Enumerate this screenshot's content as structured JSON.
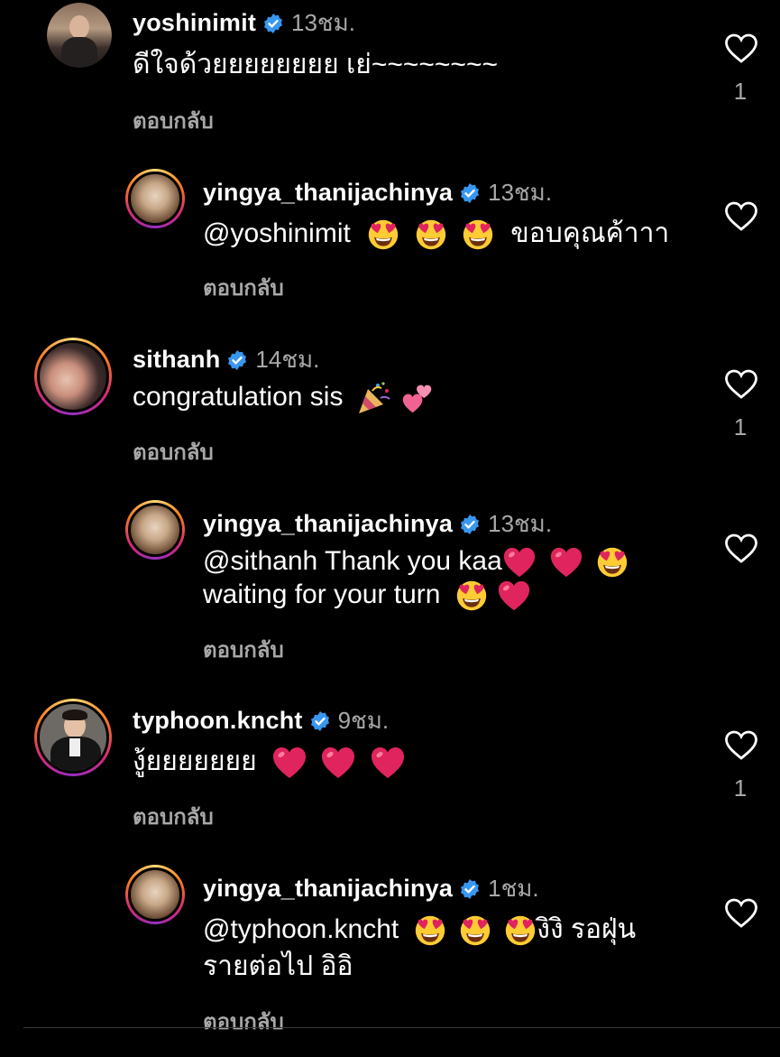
{
  "comments": [
    {
      "username": "yoshinimit",
      "time": "13ชม.",
      "text": "ดีใจด้วยยยยยยยย เย่~~~~~~~~",
      "reply_label": "ตอบกลับ",
      "likes": "1",
      "avatar_style": "plain"
    },
    {
      "username": "yingya_thanijachinya",
      "time": "13ชม.",
      "mention": "@yoshinimit",
      "text_after": "ขอบคุณค้าาา",
      "reply_label": "ตอบกลับ",
      "likes": ""
    },
    {
      "username": "sithanh",
      "time": "14ชม.",
      "text": "congratulation sis",
      "reply_label": "ตอบกลับ",
      "likes": "1"
    },
    {
      "username": "yingya_thanijachinya",
      "time": "13ชม.",
      "mention": "@sithanh",
      "text_line1": "Thank you kaa",
      "text_line2": "waiting for your turn",
      "reply_label": "ตอบกลับ",
      "likes": ""
    },
    {
      "username": "typhoon.kncht",
      "time": "9ชม.",
      "text": "งู้ยยยยยยย",
      "reply_label": "ตอบกลับ",
      "likes": "1"
    },
    {
      "username": "yingya_thanijachinya",
      "time": "1ชม.",
      "mention": "@typhoon.kncht",
      "text_line1_after": "งิงิ รอฝุ่น",
      "text_line2": "รายต่อไป อิอิ",
      "reply_label": "ตอบกลับ",
      "likes": ""
    }
  ],
  "colors": {
    "background": "#000000",
    "secondary_text": "#a8a8a8",
    "verified_badge": "#3897f0",
    "heart_emoji": "#e0245e",
    "face_emoji": "#ffcc33"
  },
  "icons": [
    "verified-badge-icon",
    "heart-outline-icon",
    "heart-eyes-emoji",
    "red-heart-emoji",
    "party-popper-emoji",
    "two-hearts-emoji"
  ]
}
